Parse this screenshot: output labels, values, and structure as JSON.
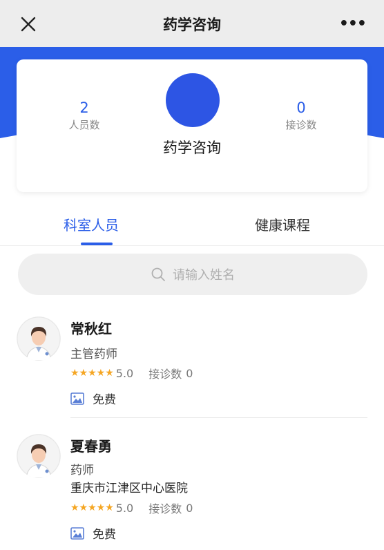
{
  "header": {
    "title": "药学咨询",
    "close_icon": "close-icon",
    "more_label": "•••"
  },
  "colors": {
    "accent": "#2b5ee8",
    "star": "#f5a623"
  },
  "department": {
    "staff_count": "2",
    "staff_label": "人员数",
    "consult_count": "0",
    "consult_label": "接诊数",
    "name": "药学咨询"
  },
  "tabs": [
    {
      "label": "科室人员",
      "active": true
    },
    {
      "label": "健康课程",
      "active": false
    }
  ],
  "search": {
    "placeholder": "请输入姓名"
  },
  "doctors": [
    {
      "name": "常秋红",
      "title": "主管药师",
      "hospital": "",
      "stars": "★★★★★",
      "rating": "5.0",
      "consult_label": "接诊数",
      "consult_count": "0",
      "fee": "免费"
    },
    {
      "name": "夏春勇",
      "title": "药师",
      "hospital": "重庆市江津区中心医院",
      "stars": "★★★★★",
      "rating": "5.0",
      "consult_label": "接诊数",
      "consult_count": "0",
      "fee": "免费"
    }
  ]
}
